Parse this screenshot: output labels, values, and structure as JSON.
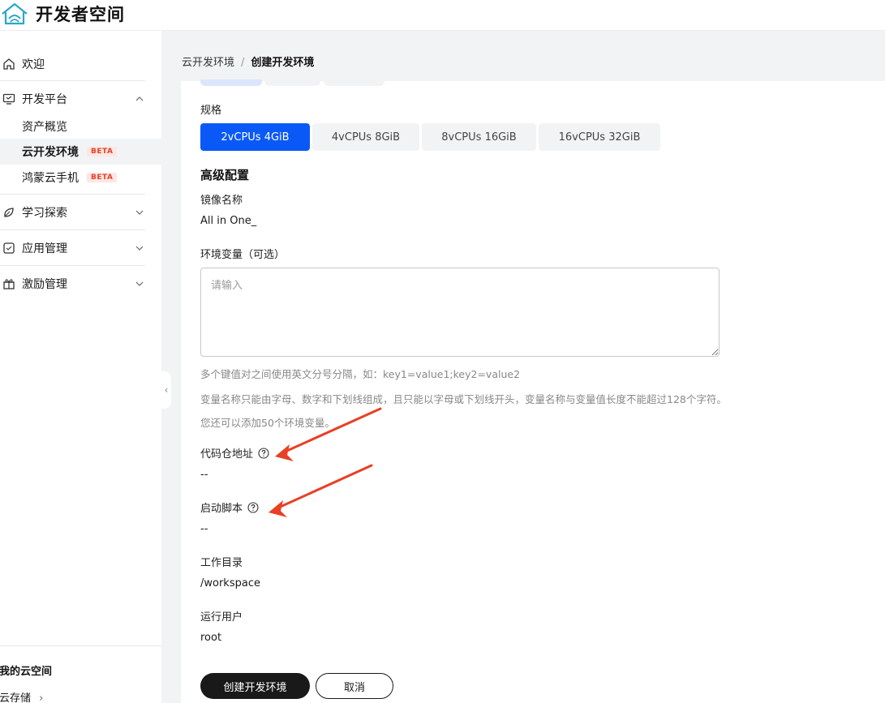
{
  "header": {
    "brand": "开发者空间"
  },
  "sidebar": {
    "items": [
      {
        "label": "欢迎"
      },
      {
        "label": "开发平台"
      },
      {
        "label": "学习探索"
      },
      {
        "label": "应用管理"
      },
      {
        "label": "激励管理"
      }
    ],
    "sub_items": [
      {
        "label": "资产概览"
      },
      {
        "label": "云开发环境",
        "badge": "BETA"
      },
      {
        "label": "鸿蒙云手机",
        "badge": "BETA"
      }
    ],
    "cloud_title": "我的云空间",
    "cloud_storage": "云存储",
    "cloud_storage_chevron": "›",
    "collapse_glyph": "‹"
  },
  "breadcrumb": {
    "parent": "云开发环境",
    "separator": "/",
    "current": "创建开发环境"
  },
  "form": {
    "spec_label": "规格",
    "specs": [
      {
        "label": "2vCPUs 4GiB",
        "active": true
      },
      {
        "label": "4vCPUs 8GiB",
        "active": false
      },
      {
        "label": "8vCPUs 16GiB",
        "active": false
      },
      {
        "label": "16vCPUs 32GiB",
        "active": false
      }
    ],
    "advanced_title": "高级配置",
    "image_label": "镜像名称",
    "image_value": "All in One_",
    "env_label": "环境变量（可选）",
    "env_placeholder": "请输入",
    "env_value": "",
    "hint1": "多个键值对之间使用英文分号分隔，如：key1=value1;key2=value2",
    "hint2": "变量名称只能由字母、数字和下划线组成，且只能以字母或下划线开头，变量名称与变量值长度不能超过128个字符。",
    "hint3": "您还可以添加50个环境变量。",
    "repo_label": "代码仓地址",
    "repo_value": "--",
    "script_label": "启动脚本",
    "script_value": "--",
    "workdir_label": "工作目录",
    "workdir_value": "/workspace",
    "user_label": "运行用户",
    "user_value": "root"
  },
  "actions": {
    "create": "创建开发环境",
    "cancel": "取消"
  },
  "colors": {
    "accent": "#0a59f7",
    "annotation_arrow": "#e84026",
    "primary_button": "#191919"
  }
}
